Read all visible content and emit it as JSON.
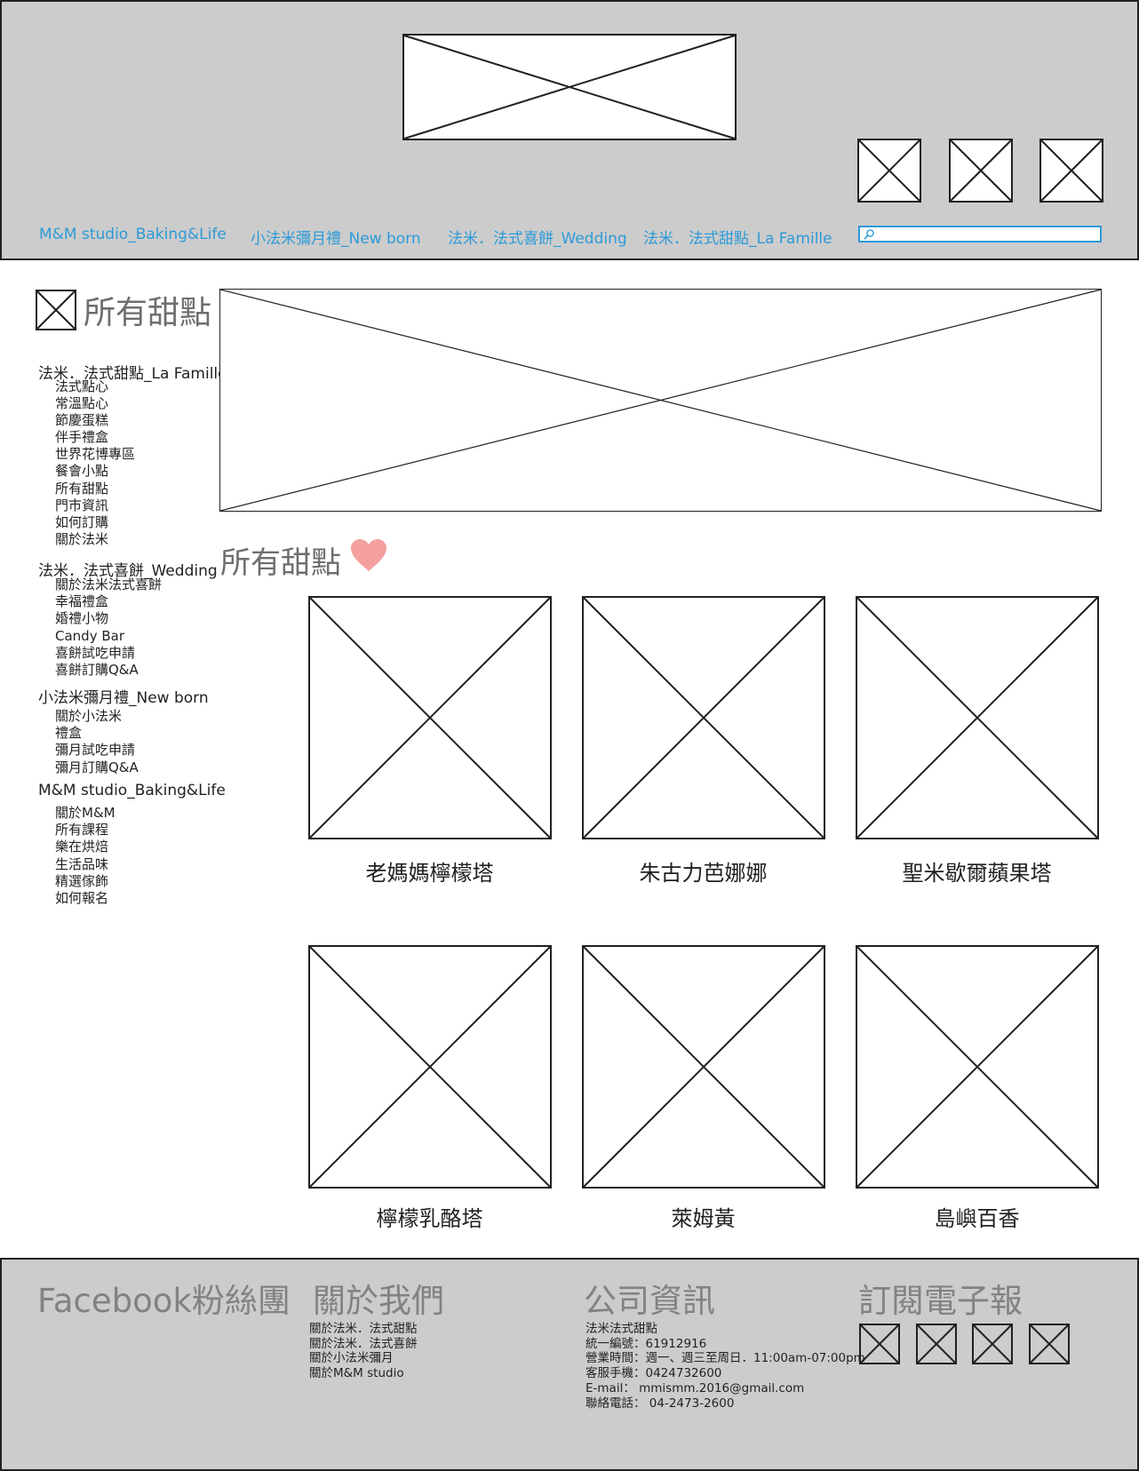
{
  "header": {
    "nav": [
      {
        "label": "M&M studio_Baking&Life"
      },
      {
        "label": "小法米彌月禮_New born"
      },
      {
        "label": "法米．法式喜餅_Wedding"
      },
      {
        "label": "法米．法式甜點_La Famille"
      }
    ],
    "search": {
      "value": "",
      "placeholder": ""
    }
  },
  "sidebar": {
    "title": "所有甜點",
    "groups": [
      {
        "title": "法米．法式甜點_La Famille",
        "items": [
          "法式點心",
          "常溫點心",
          "節慶蛋糕",
          "伴手禮盒",
          "世界花博專區",
          "餐會小點",
          "所有甜點",
          "門市資訊",
          "如何訂購",
          "關於法米"
        ]
      },
      {
        "title": "法米．法式喜餅_Wedding",
        "items": [
          "關於法米法式喜餅",
          "幸福禮盒",
          "婚禮小物",
          "Candy Bar",
          "喜餅試吃申請",
          "喜餅訂購Q&A"
        ]
      },
      {
        "title": "小法米彌月禮_New born",
        "items": [
          "關於小法米",
          "禮盒",
          "彌月試吃申請",
          "彌月訂購Q&A"
        ]
      },
      {
        "title": "M&M studio_Baking&Life",
        "items": [
          "關於M&M",
          "所有課程",
          "樂在烘焙",
          "生活品味",
          "精選傢飾",
          "如何報名"
        ]
      }
    ]
  },
  "main": {
    "section_title": "所有甜點",
    "heart_color": "#f4a09f",
    "products": [
      {
        "name": "老媽媽檸檬塔"
      },
      {
        "name": "朱古力芭娜娜"
      },
      {
        "name": "聖米歇爾蘋果塔"
      },
      {
        "name": "檸檬乳酪塔"
      },
      {
        "name": "萊姆黃"
      },
      {
        "name": "島嶼百香"
      }
    ]
  },
  "footer": {
    "facebook": {
      "title": "Facebook粉絲團"
    },
    "about": {
      "title": "關於我們",
      "lines": [
        "關於法米．法式甜點",
        "關於法米．法式喜餅",
        "關於小法米彌月",
        "關於M&M studio"
      ]
    },
    "company": {
      "title": "公司資訊",
      "lines": [
        "法米法式甜點",
        "統一編號：61912916",
        "營業時間：週一、週三至周日．11:00am-07:00pm",
        "客服手機：0424732600",
        "E-mail： mmismm.2016@gmail.com",
        "聯絡電話： 04-2473-2600"
      ]
    },
    "newsletter": {
      "title": "訂閱電子報"
    }
  },
  "colors": {
    "header_bg": "#cccccc",
    "link": "#2c9ad8",
    "heart": "#f4a09f",
    "heading_gray": "#6d6e70"
  }
}
